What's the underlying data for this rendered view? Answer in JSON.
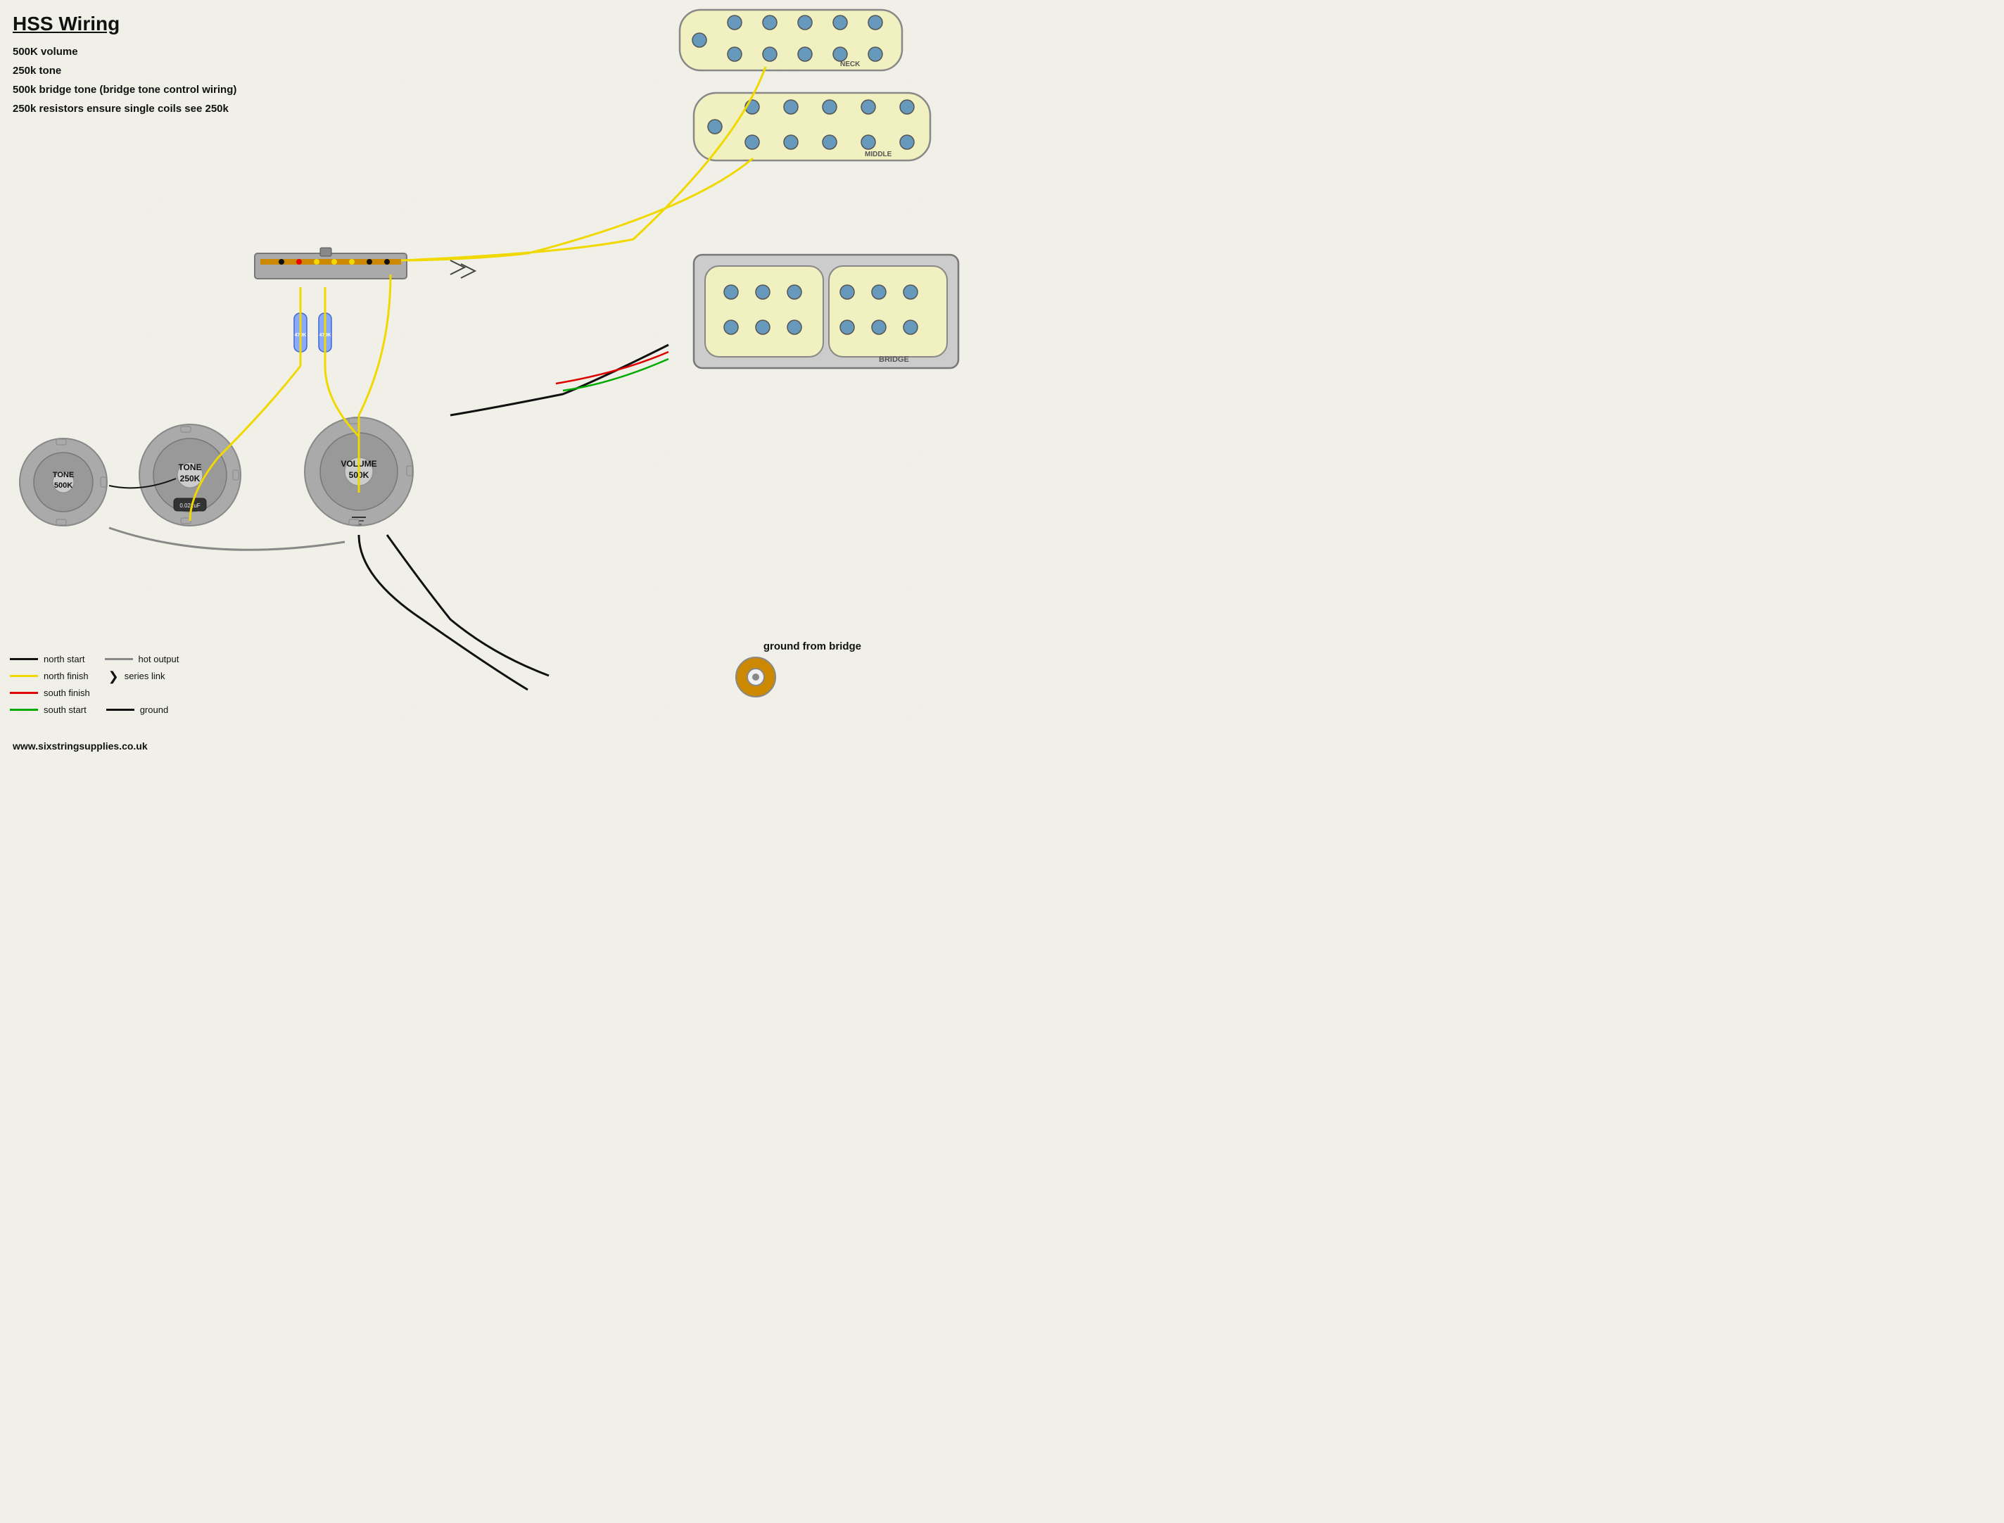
{
  "title": "HSS Wiring",
  "info": {
    "line1": "500K volume",
    "line2": "250k tone",
    "line3": "500k bridge tone (bridge tone control wiring)",
    "line4": "250k resistors ensure single coils see 250k"
  },
  "website": "www.sixstringsupplies.co.uk",
  "pickups": {
    "neck_label": "NECK",
    "middle_label": "MIDDLE",
    "bridge_label": "BRIDGE"
  },
  "pots": {
    "tone1_label": "TONE",
    "tone1_value": "500K",
    "tone2_label": "TONE",
    "tone2_value": "250K",
    "volume_label": "VOLUME",
    "volume_value": "500K"
  },
  "capacitor": "0.022uF",
  "resistors": {
    "r1": "470K",
    "r2": "470K"
  },
  "ground_label": "ground from bridge",
  "legend": {
    "north_start": "north start",
    "hot_output": "hot output",
    "north_finish": "north finish",
    "series_link": "series link",
    "south_finish": "south finish",
    "south_start": "south start",
    "ground": "ground",
    "colors": {
      "black": "#111111",
      "yellow": "#f0d800",
      "red": "#e00000",
      "green": "#00aa00",
      "gray": "#888888"
    }
  }
}
